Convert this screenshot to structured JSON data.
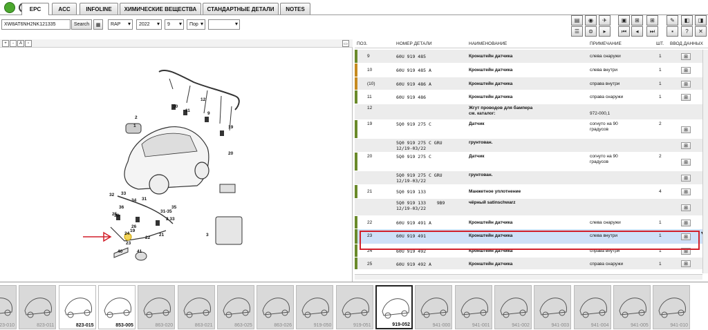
{
  "tabs": [
    {
      "label": "EPC",
      "active": true
    },
    {
      "label": "ACC"
    },
    {
      "label": "INFOLINE"
    },
    {
      "label": "ХИМИЧЕСКИЕ ВЕЩЕСТВА"
    },
    {
      "label": "СТАНДАРТНЫЕ ДЕТАЛИ"
    },
    {
      "label": "NOTES"
    }
  ],
  "toolbar": {
    "vin": "XW8AT6NH2NK121335",
    "search_label": "Search",
    "model": "RAP",
    "year": "2022",
    "month": "9",
    "lang": "Пор",
    "extra": ""
  },
  "parts_header": {
    "pos": "ПОЗ.",
    "part_no": "НОМЕР ДЕТАЛИ",
    "name": "НАИМЕНОВАНИЕ",
    "note": "ПРИМЕЧАНИЕ",
    "qty": "ШТ.",
    "input": "ВВОД ДАННЫХ"
  },
  "parts": [
    {
      "pos": "9",
      "part": "60U 919 485",
      "name": "Кронштейн датчика",
      "note": "слева снаружи",
      "qty": "1",
      "bar": "#6a8a2a"
    },
    {
      "pos": "10",
      "part": "60U 919 485 A",
      "name": "Кронштейн датчика",
      "note": "слева внутри",
      "qty": "1",
      "bar": "#c68a1e"
    },
    {
      "pos": "(10)",
      "part": "60U 919 486 A",
      "name": "Кронштейн датчика",
      "note": "справа внутри",
      "qty": "1",
      "bar": "#c68a1e"
    },
    {
      "pos": "11",
      "part": "60U 919 486",
      "name": "Кронштейн датчика",
      "note": "справа снаружи",
      "qty": "1",
      "bar": "#6a8a2a"
    },
    {
      "pos": "12",
      "part": "",
      "name": "Жгут проводов для бампера\nсм. каталог:",
      "note": "\n972-000,1",
      "qty": "",
      "bar": ""
    },
    {
      "pos": "19",
      "part": "5Q0 919 275 C",
      "name": "Датчик",
      "note": "согнуто на 90\nградусов",
      "qty": "2",
      "bar": "#6a8a2a"
    },
    {
      "pos": "",
      "part": "5Q0 919 275 C GRU\n12/19-03/22",
      "name": "грунтован.",
      "note": "",
      "qty": "",
      "bar": ""
    },
    {
      "pos": "20",
      "part": "5Q0 919 275 C",
      "name": "Датчик",
      "note": "согнуто на 90\nградусов",
      "qty": "2",
      "bar": "#6a8a2a"
    },
    {
      "pos": "",
      "part": "5Q0 919 275 C GRU\n12/19-03/22",
      "name": "грунтован.",
      "note": "",
      "qty": "",
      "bar": ""
    },
    {
      "pos": "21",
      "part": "5Q0 919 133",
      "name": "Манжетное уплотнение",
      "note": "",
      "qty": "4",
      "bar": "#6a8a2a"
    },
    {
      "pos": "",
      "part": "5Q0 919 133    9B9\n12/19-03/22",
      "name": "чёрный satinschwarz",
      "note": "",
      "qty": "",
      "bar": ""
    },
    {
      "pos": "22",
      "part": "60U 919 491 A",
      "name": "Кронштейн датчика",
      "note": "слева снаружи",
      "qty": "1",
      "bar": "#6a8a2a"
    },
    {
      "pos": "23",
      "part": "60U 919 491",
      "name": "Кронштейн датчика",
      "note": "слева внутри",
      "qty": "1",
      "bar": "#6a8a2a",
      "selected": true
    },
    {
      "pos": "24",
      "part": "60U 919 492",
      "name": "Кронштейн датчика",
      "note": "справа внутри",
      "qty": "1",
      "bar": "#6a8a2a"
    },
    {
      "pos": "25",
      "part": "60U 919 492 A",
      "name": "Кронштейн датчика",
      "note": "справа снаружи",
      "qty": "1",
      "bar": "#6a8a2a"
    }
  ],
  "callouts": [
    "12",
    "2",
    "1",
    "10",
    "11",
    "9",
    "19",
    "20",
    "32",
    "33",
    "34",
    "36",
    "31",
    "30",
    "35",
    "25",
    "31-35",
    "2 33",
    "26",
    "19",
    "24",
    "22",
    "23",
    "21",
    "40",
    "41",
    "3"
  ],
  "thumbs": [
    {
      "label": "823-010"
    },
    {
      "label": "823-011"
    },
    {
      "label": "823-015",
      "light": true
    },
    {
      "label": "853-005",
      "light": true
    },
    {
      "label": "863-020"
    },
    {
      "label": "863-021"
    },
    {
      "label": "863-025"
    },
    {
      "label": "863-026"
    },
    {
      "label": "919-050"
    },
    {
      "label": "919-051"
    },
    {
      "label": "919-052",
      "current": true
    },
    {
      "label": "941-000"
    },
    {
      "label": "941-001"
    },
    {
      "label": "941-002"
    },
    {
      "label": "941-003"
    },
    {
      "label": "941-004"
    },
    {
      "label": "941-005"
    },
    {
      "label": "941-010"
    }
  ]
}
